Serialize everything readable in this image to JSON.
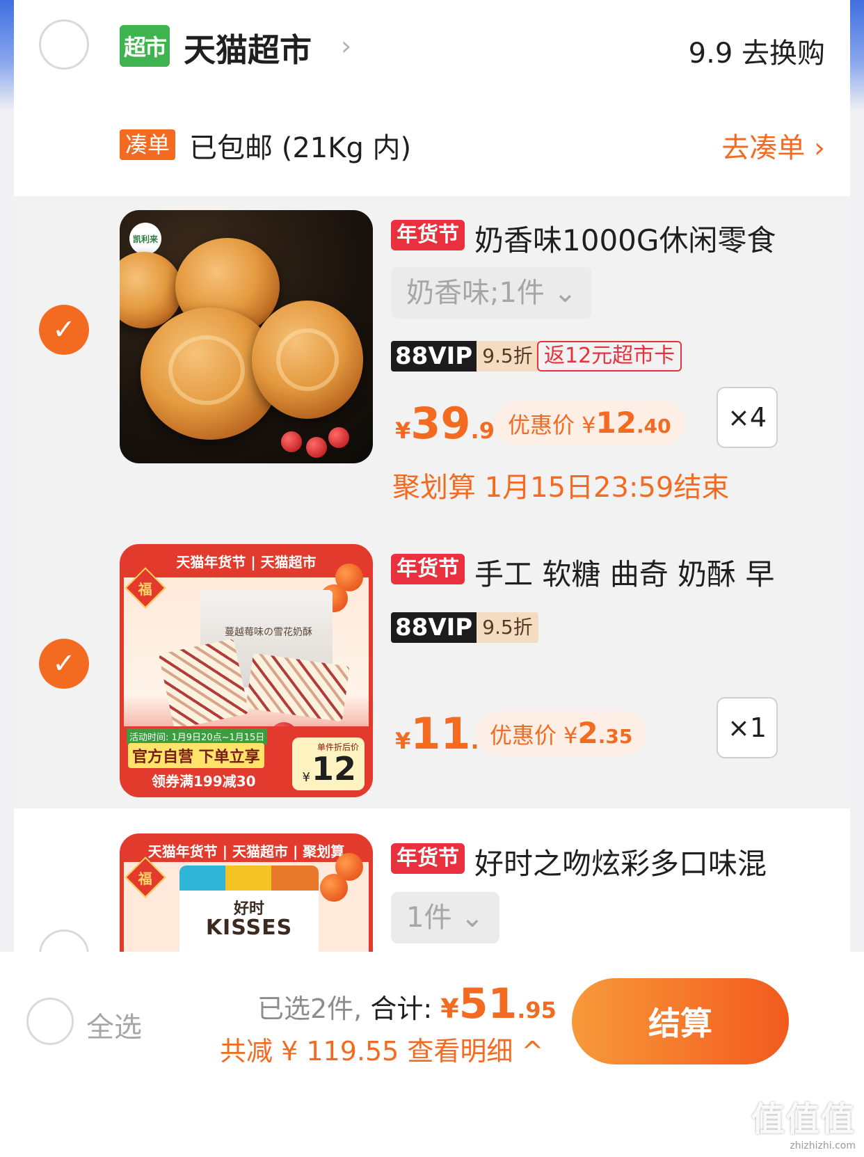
{
  "store": {
    "logo_text": "超市",
    "name": "天猫超市",
    "chevron": "›",
    "swap_link": "9.9 去换购",
    "coudan_tag": "凑单",
    "shipping_text": "已包邮 (21Kg 内)",
    "go_coudan": "去凑单 ›"
  },
  "items": [
    {
      "checked": "✓",
      "brand_badge": "凯利来",
      "tag": "年货节",
      "title": "奶香味1000G休闲零食",
      "sku": "奶香味;1件 ⌄",
      "vip_label": "88VIP",
      "vip_discount": "9.5折",
      "return_card": "返12元超市卡",
      "price_yen": "¥",
      "price_int": "39",
      "price_dec": ".9",
      "deal_label": "优惠价 ¥",
      "deal_int": "12",
      "deal_dec": ".40",
      "qty": "×4",
      "jhs": "聚划算 1月15日23:59结束"
    },
    {
      "checked": "✓",
      "tag": "年货节",
      "title": "手工 软糖 曲奇 奶酥 早",
      "vip_label": "88VIP",
      "vip_discount": "9.5折",
      "price_yen": "¥",
      "price_int": "11",
      "price_dec": ".9",
      "deal_label": "优惠价 ¥",
      "deal_int": "2",
      "deal_dec": ".35",
      "qty": "×1",
      "thumb": {
        "top_text": "天猫年货节 | 天猫超市",
        "fu": "福",
        "bag_text": "蔓越莓味の雪花奶酥",
        "date_text": "活动时间: 1月9日20点~1月15日",
        "yellow_text": "官方自营 下单立享",
        "coupon_text": "领券满199减30",
        "price_label": "单件折后价",
        "price_yen": "¥",
        "price_value": "12"
      }
    },
    {
      "tag": "年货节",
      "title": "好时之吻炫彩多口味混",
      "sku": "1件 ⌄",
      "thumb": {
        "top_text": "天猫年货节 | 天猫超市 | 聚划算",
        "fu": "福",
        "brand_cn": "好时",
        "brand_en": "KISSES"
      }
    }
  ],
  "footer": {
    "select_all": "全选",
    "selected_count": "已选2件,",
    "total_label": "合计:",
    "total_yen": "¥",
    "total_int": "51",
    "total_dec": ".95",
    "reduce_text": "共减 ¥ 119.55  查看明细 ^",
    "checkout": "结算"
  },
  "watermark": {
    "big": "值值值",
    "small": "zhizhizhi.com"
  },
  "colors": {
    "accent_orange": "#f36b21",
    "tag_red": "#e9313d",
    "tmall_green": "#3fb34f"
  }
}
